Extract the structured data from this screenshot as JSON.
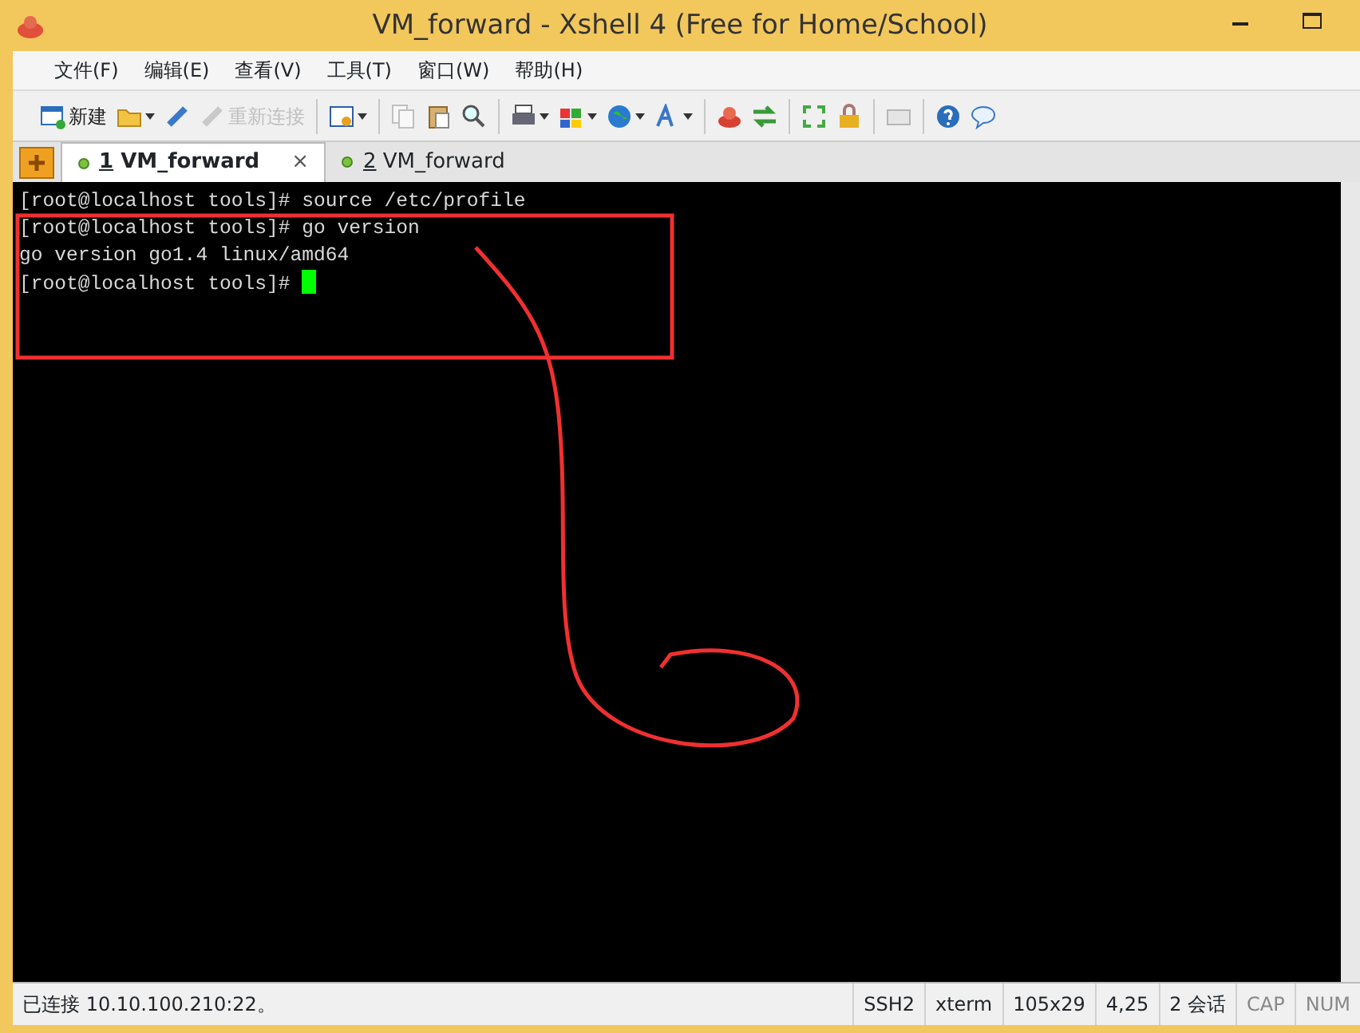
{
  "window": {
    "title": "VM_forward - Xshell 4 (Free for Home/School)"
  },
  "menu": [
    "文件(F)",
    "编辑(E)",
    "查看(V)",
    "工具(T)",
    "窗口(W)",
    "帮助(H)"
  ],
  "toolbar": [
    {
      "kind": "button",
      "label": "新建",
      "caret": false,
      "disabled": false
    },
    {
      "kind": "button",
      "caret": true,
      "disabled": false
    },
    {
      "kind": "button",
      "caret": false,
      "disabled": false
    },
    {
      "kind": "button",
      "label": "重新连接",
      "caret": false,
      "disabled": true
    },
    {
      "kind": "separator"
    },
    {
      "kind": "button",
      "caret": true,
      "disabled": false
    },
    {
      "kind": "separator"
    },
    {
      "kind": "button",
      "caret": false,
      "disabled": true
    },
    {
      "kind": "button",
      "caret": false,
      "disabled": false
    },
    {
      "kind": "button",
      "caret": false,
      "disabled": false
    },
    {
      "kind": "separator"
    },
    {
      "kind": "button",
      "caret": true,
      "disabled": false
    },
    {
      "kind": "button",
      "caret": true,
      "disabled": false
    },
    {
      "kind": "button",
      "caret": true,
      "disabled": false
    },
    {
      "kind": "button",
      "caret": true,
      "disabled": false
    },
    {
      "kind": "separator"
    },
    {
      "kind": "button",
      "caret": false,
      "disabled": false
    },
    {
      "kind": "button",
      "caret": false,
      "disabled": false
    },
    {
      "kind": "separator"
    },
    {
      "kind": "button",
      "caret": false,
      "disabled": false
    },
    {
      "kind": "button",
      "caret": false,
      "disabled": false
    },
    {
      "kind": "separator"
    },
    {
      "kind": "button",
      "caret": false,
      "disabled": true
    },
    {
      "kind": "separator"
    },
    {
      "kind": "button",
      "caret": false,
      "disabled": false
    },
    {
      "kind": "button",
      "caret": false,
      "disabled": false
    }
  ],
  "tabs": [
    {
      "number": "1",
      "label": "VM_forward",
      "selected": true,
      "close": "×"
    },
    {
      "number": "2",
      "label": "VM_forward",
      "selected": false
    }
  ],
  "terminal": {
    "lines": [
      {
        "text": "[root@localhost tools]# source /etc/profile",
        "cursor": false
      },
      {
        "text": "[root@localhost tools]# go version",
        "cursor": false
      },
      {
        "text": "go version go1.4 linux/amd64",
        "cursor": false
      },
      {
        "text": "[root@localhost tools]# ",
        "cursor": true
      }
    ]
  },
  "status_bar": {
    "message": "已连接 10.10.100.210:22。",
    "fields": [
      "SSH2",
      "xterm",
      "105x29",
      "4,25",
      "2 会话",
      "CAP",
      "NUM"
    ]
  }
}
